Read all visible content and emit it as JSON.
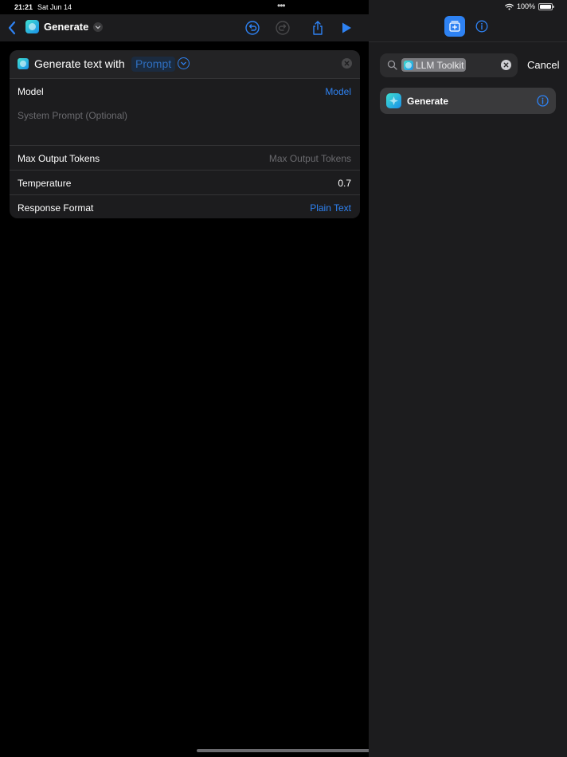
{
  "status_bar": {
    "time": "21:21",
    "date": "Sat Jun 14",
    "battery": "100%",
    "battery_level": 1.0
  },
  "toolbar": {
    "title": "Generate",
    "icons": [
      "back-chevron-icon",
      "undo-icon",
      "redo-icon",
      "share-icon",
      "play-icon"
    ]
  },
  "action_card": {
    "header_text": "Generate text with",
    "prompt_token": "Prompt",
    "rows": [
      {
        "label": "Model",
        "value": "Model"
      },
      {
        "placeholder": "System Prompt (Optional)"
      },
      {
        "label": "Max Output Tokens",
        "value": "Max Output Tokens"
      },
      {
        "label": "Temperature",
        "value": "0.7"
      },
      {
        "label": "Response Format",
        "value": "Plain Text"
      }
    ]
  },
  "right_panel": {
    "search": {
      "token": "LLM Toolkit"
    },
    "cancel_label": "Cancel",
    "results": [
      {
        "label": "Generate"
      }
    ]
  },
  "colors": {
    "accent": "#2e82f3",
    "panel": "#1c1c1e",
    "background": "#000000"
  }
}
